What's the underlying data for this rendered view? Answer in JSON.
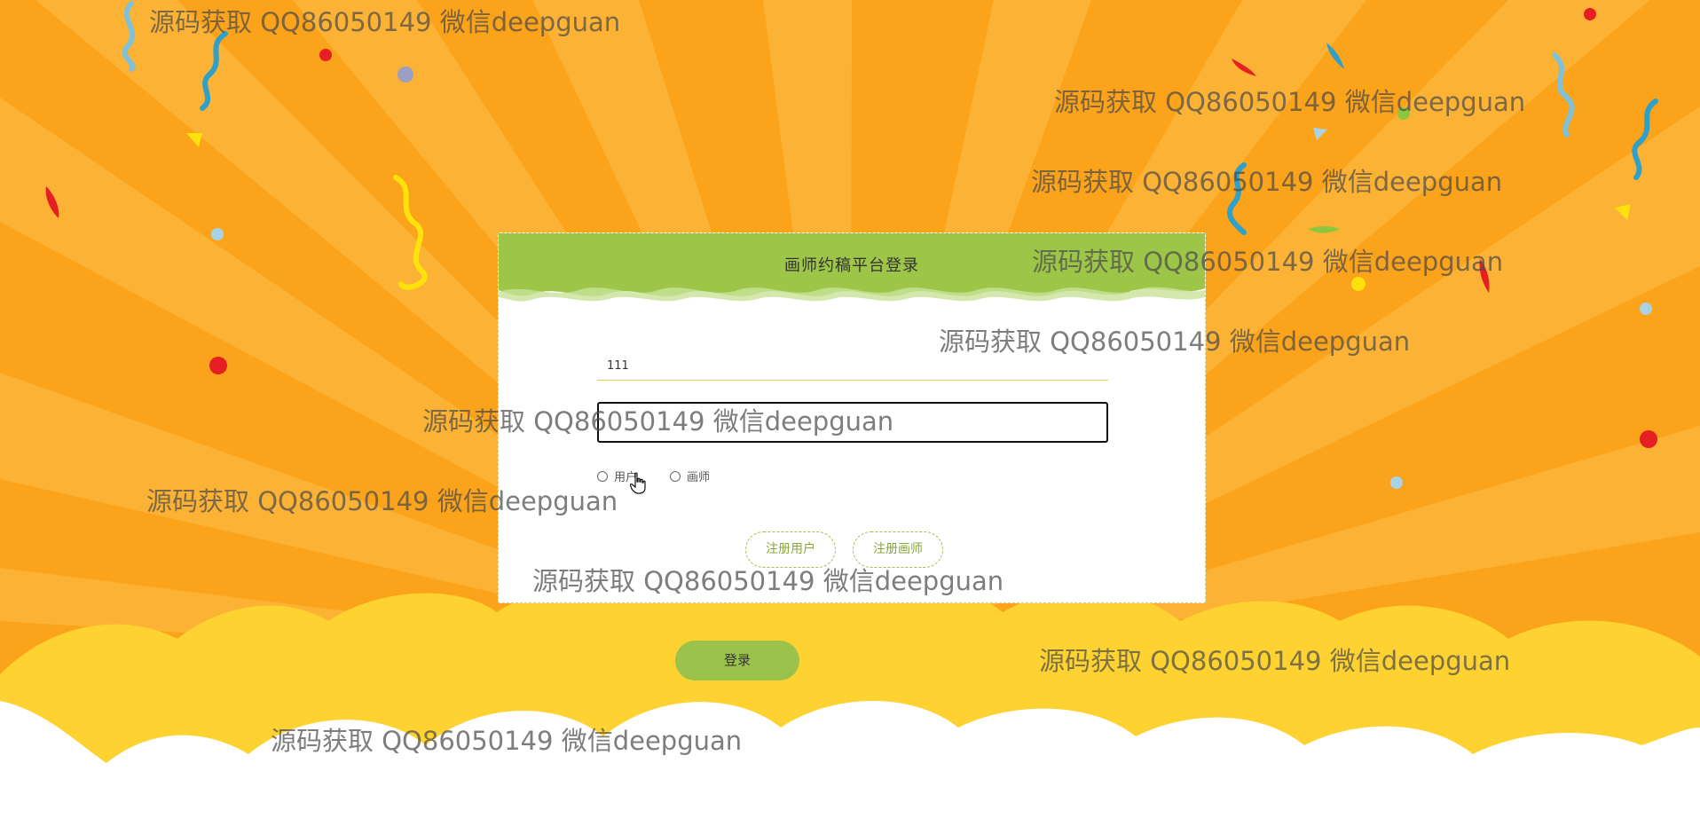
{
  "login_card": {
    "title": "画师约稿平台登录",
    "username_value": "111",
    "password_value": "",
    "roles": [
      {
        "label": "用户",
        "selected": false
      },
      {
        "label": "画师",
        "selected": false
      }
    ],
    "register_user_label": "注册用户",
    "register_artist_label": "注册画师"
  },
  "login_button_label": "登录",
  "watermark": "源码获取 QQ86050149 微信deepguan",
  "colors": {
    "sky_orange": "#fba31a",
    "ray_light": "#fdc04a",
    "cloud_yellow": "#fdd231",
    "card_header_green": "#9dc648",
    "login_green": "#9bc24a",
    "input_underline": "#dccf58"
  }
}
